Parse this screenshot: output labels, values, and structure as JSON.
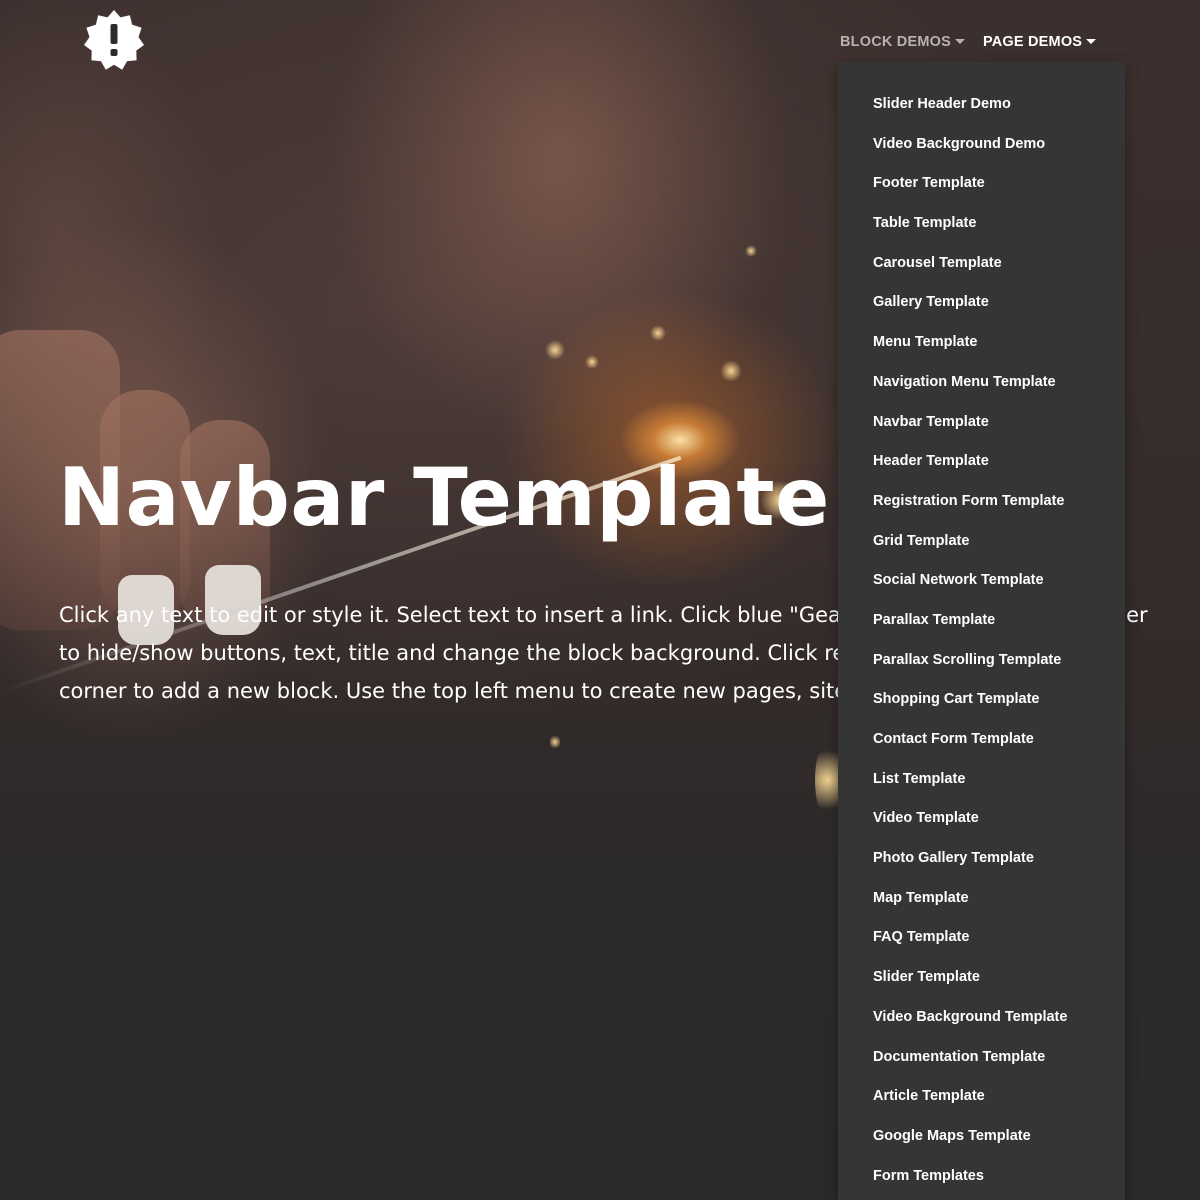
{
  "brand": {
    "logo_icon": "exclamation-badge-icon"
  },
  "navbar": {
    "items": [
      {
        "label": "BLOCK DEMOS",
        "state": "default"
      },
      {
        "label": "PAGE DEMOS",
        "state": "open"
      }
    ]
  },
  "hero": {
    "title": "Navbar Template",
    "text": "Click any text to edit or style it. Select text to insert a link. Click blue \"Gear\" icon in the top right corner to hide/show buttons, text, title and change the block background. Click red \"+\" in the bottom right corner to add a new block. Use the top left menu to create new pages, sites and add themes."
  },
  "dropdown": {
    "items": [
      "Slider Header Demo",
      "Video Background Demo",
      "Footer Template",
      "Table Template",
      "Carousel Template",
      "Gallery Template",
      "Menu Template",
      "Navigation Menu Template",
      "Navbar Template",
      "Header Template",
      "Registration Form Template",
      "Grid Template",
      "Social Network Template",
      "Parallax Template",
      "Parallax Scrolling Template",
      "Shopping Cart Template",
      "Contact Form Template",
      "List Template",
      "Video Template",
      "Photo Gallery Template",
      "Map Template",
      "FAQ Template",
      "Slider Template",
      "Video Background Template",
      "Documentation Template",
      "Article Template",
      "Google Maps Template",
      "Form Templates"
    ]
  },
  "colors": {
    "dropdown_bg": "#353535",
    "nav_muted": "#b8b2b0",
    "text": "#ffffff"
  }
}
